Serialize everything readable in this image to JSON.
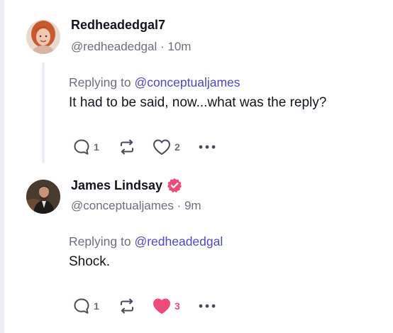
{
  "posts": [
    {
      "author": {
        "display_name": "Redheadedgal7",
        "handle": "@redheadedgal",
        "time": "10m",
        "verified": false,
        "avatar": "woman-red-hair-avatar"
      },
      "replying_prefix": "Replying to",
      "replying_to": "@conceptualjames",
      "text": "It had to be said, now...what was the reply?",
      "actions": {
        "reply_count": "1",
        "repost_count": "",
        "like_count": "2",
        "liked": false
      }
    },
    {
      "author": {
        "display_name": "James Lindsay",
        "handle": "@conceptualjames",
        "time": "9m",
        "verified": true,
        "avatar": "man-portrait-avatar"
      },
      "replying_prefix": "Replying to",
      "replying_to": "@redheadedgal",
      "text": "Shock.",
      "actions": {
        "reply_count": "1",
        "repost_count": "",
        "like_count": "3",
        "liked": true
      }
    }
  ],
  "separator": " · ",
  "icons": {
    "reply": "speech-bubble-icon",
    "repost": "repost-arrows-icon",
    "like": "heart-icon",
    "more": "more-dots-icon",
    "verified": "verified-badge-icon"
  },
  "colors": {
    "accent_link": "#5046c8",
    "like_active": "#ef4b7a",
    "verified_badge": "#ef4b7a",
    "muted_text": "#6e6e7c",
    "thread_line": "#ececf3"
  }
}
